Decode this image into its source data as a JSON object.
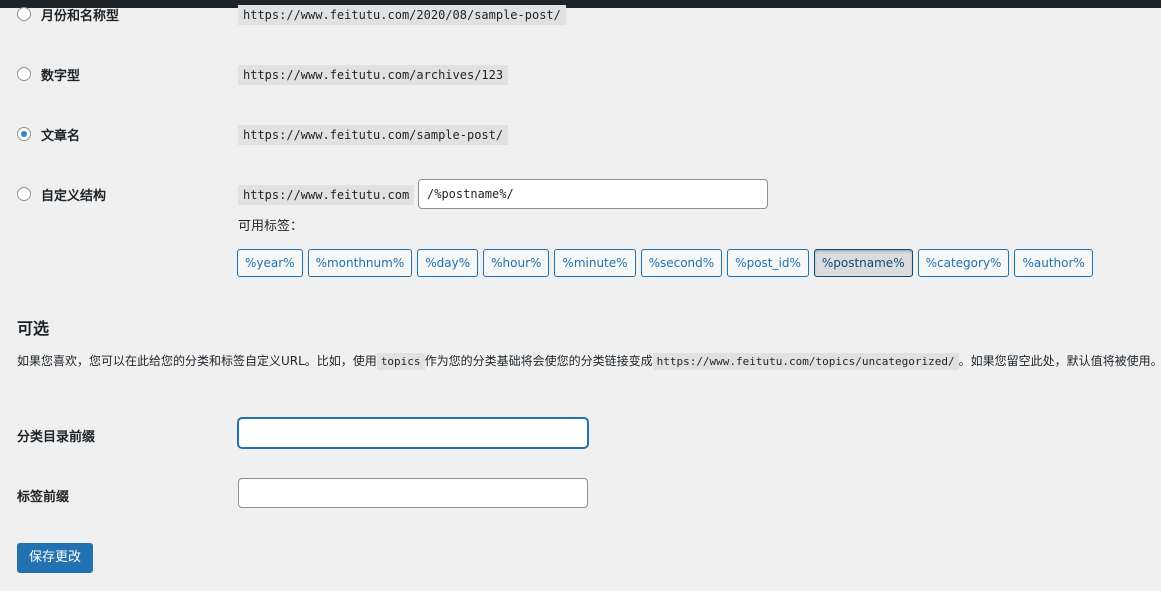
{
  "options": [
    {
      "label": "月份和名称型",
      "example": "https://www.feitutu.com/2020/08/sample-post/",
      "checked": false
    },
    {
      "label": "数字型",
      "example": "https://www.feitutu.com/archives/123",
      "checked": false
    },
    {
      "label": "文章名",
      "example": "https://www.feitutu.com/sample-post/",
      "checked": true
    },
    {
      "label": "自定义结构",
      "example": "https://www.feitutu.com",
      "checked": false
    }
  ],
  "custom_structure": {
    "value": "/%postname%/"
  },
  "available_tags": {
    "label": "可用标签：",
    "tags": [
      "%year%",
      "%monthnum%",
      "%day%",
      "%hour%",
      "%minute%",
      "%second%",
      "%post_id%",
      "%postname%",
      "%category%",
      "%author%"
    ],
    "active": "%postname%"
  },
  "optional": {
    "heading": "可选",
    "desc_1": "如果您喜欢，您可以在此给您的分类和标签自定义URL。比如，使用",
    "desc_code_1": "topics",
    "desc_2": "作为您的分类基础将会使您的分类链接变成",
    "desc_code_2": "https://www.feitutu.com/topics/uncategorized/",
    "desc_3": "。如果您留空此处，默认值将被使用。"
  },
  "fields": {
    "category_base_label": "分类目录前缀",
    "category_base_value": "",
    "tag_base_label": "标签前缀",
    "tag_base_value": ""
  },
  "save_button": "保存更改"
}
